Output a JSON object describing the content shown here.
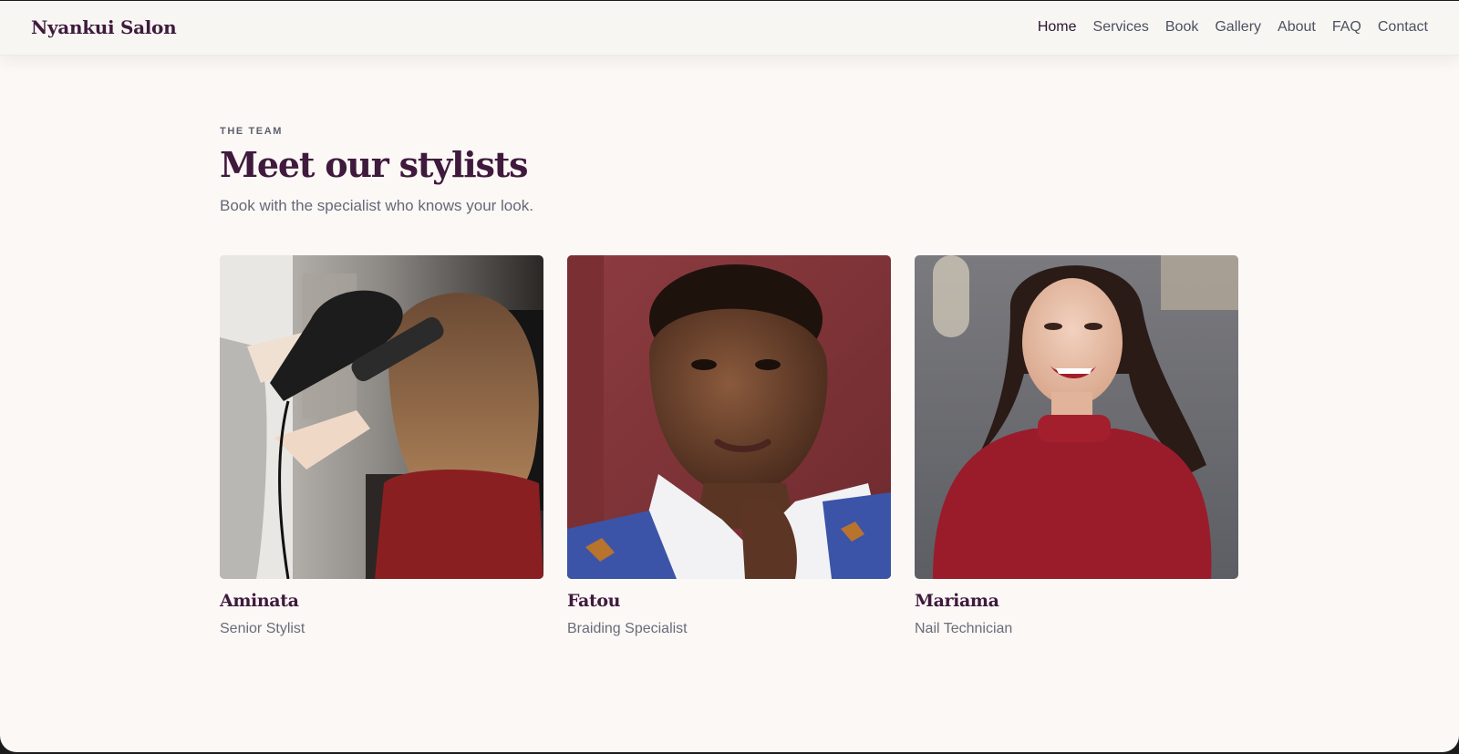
{
  "header": {
    "brand": "Nyankui Salon",
    "nav": [
      {
        "label": "Home",
        "active": true
      },
      {
        "label": "Services",
        "active": false
      },
      {
        "label": "Book",
        "active": false
      },
      {
        "label": "Gallery",
        "active": false
      },
      {
        "label": "About",
        "active": false
      },
      {
        "label": "FAQ",
        "active": false
      },
      {
        "label": "Contact",
        "active": false
      }
    ]
  },
  "team": {
    "eyebrow": "THE TEAM",
    "title": "Meet our stylists",
    "subtitle": "Book with the specialist who knows your look.",
    "stylists": [
      {
        "name": "Aminata",
        "role": "Senior Stylist"
      },
      {
        "name": "Fatou",
        "role": "Braiding Specialist"
      },
      {
        "name": "Mariama",
        "role": "Nail Technician"
      }
    ]
  },
  "colors": {
    "brand": "#3f1a3d",
    "page_bg": "#fbf8f5",
    "muted_text": "#656878"
  }
}
